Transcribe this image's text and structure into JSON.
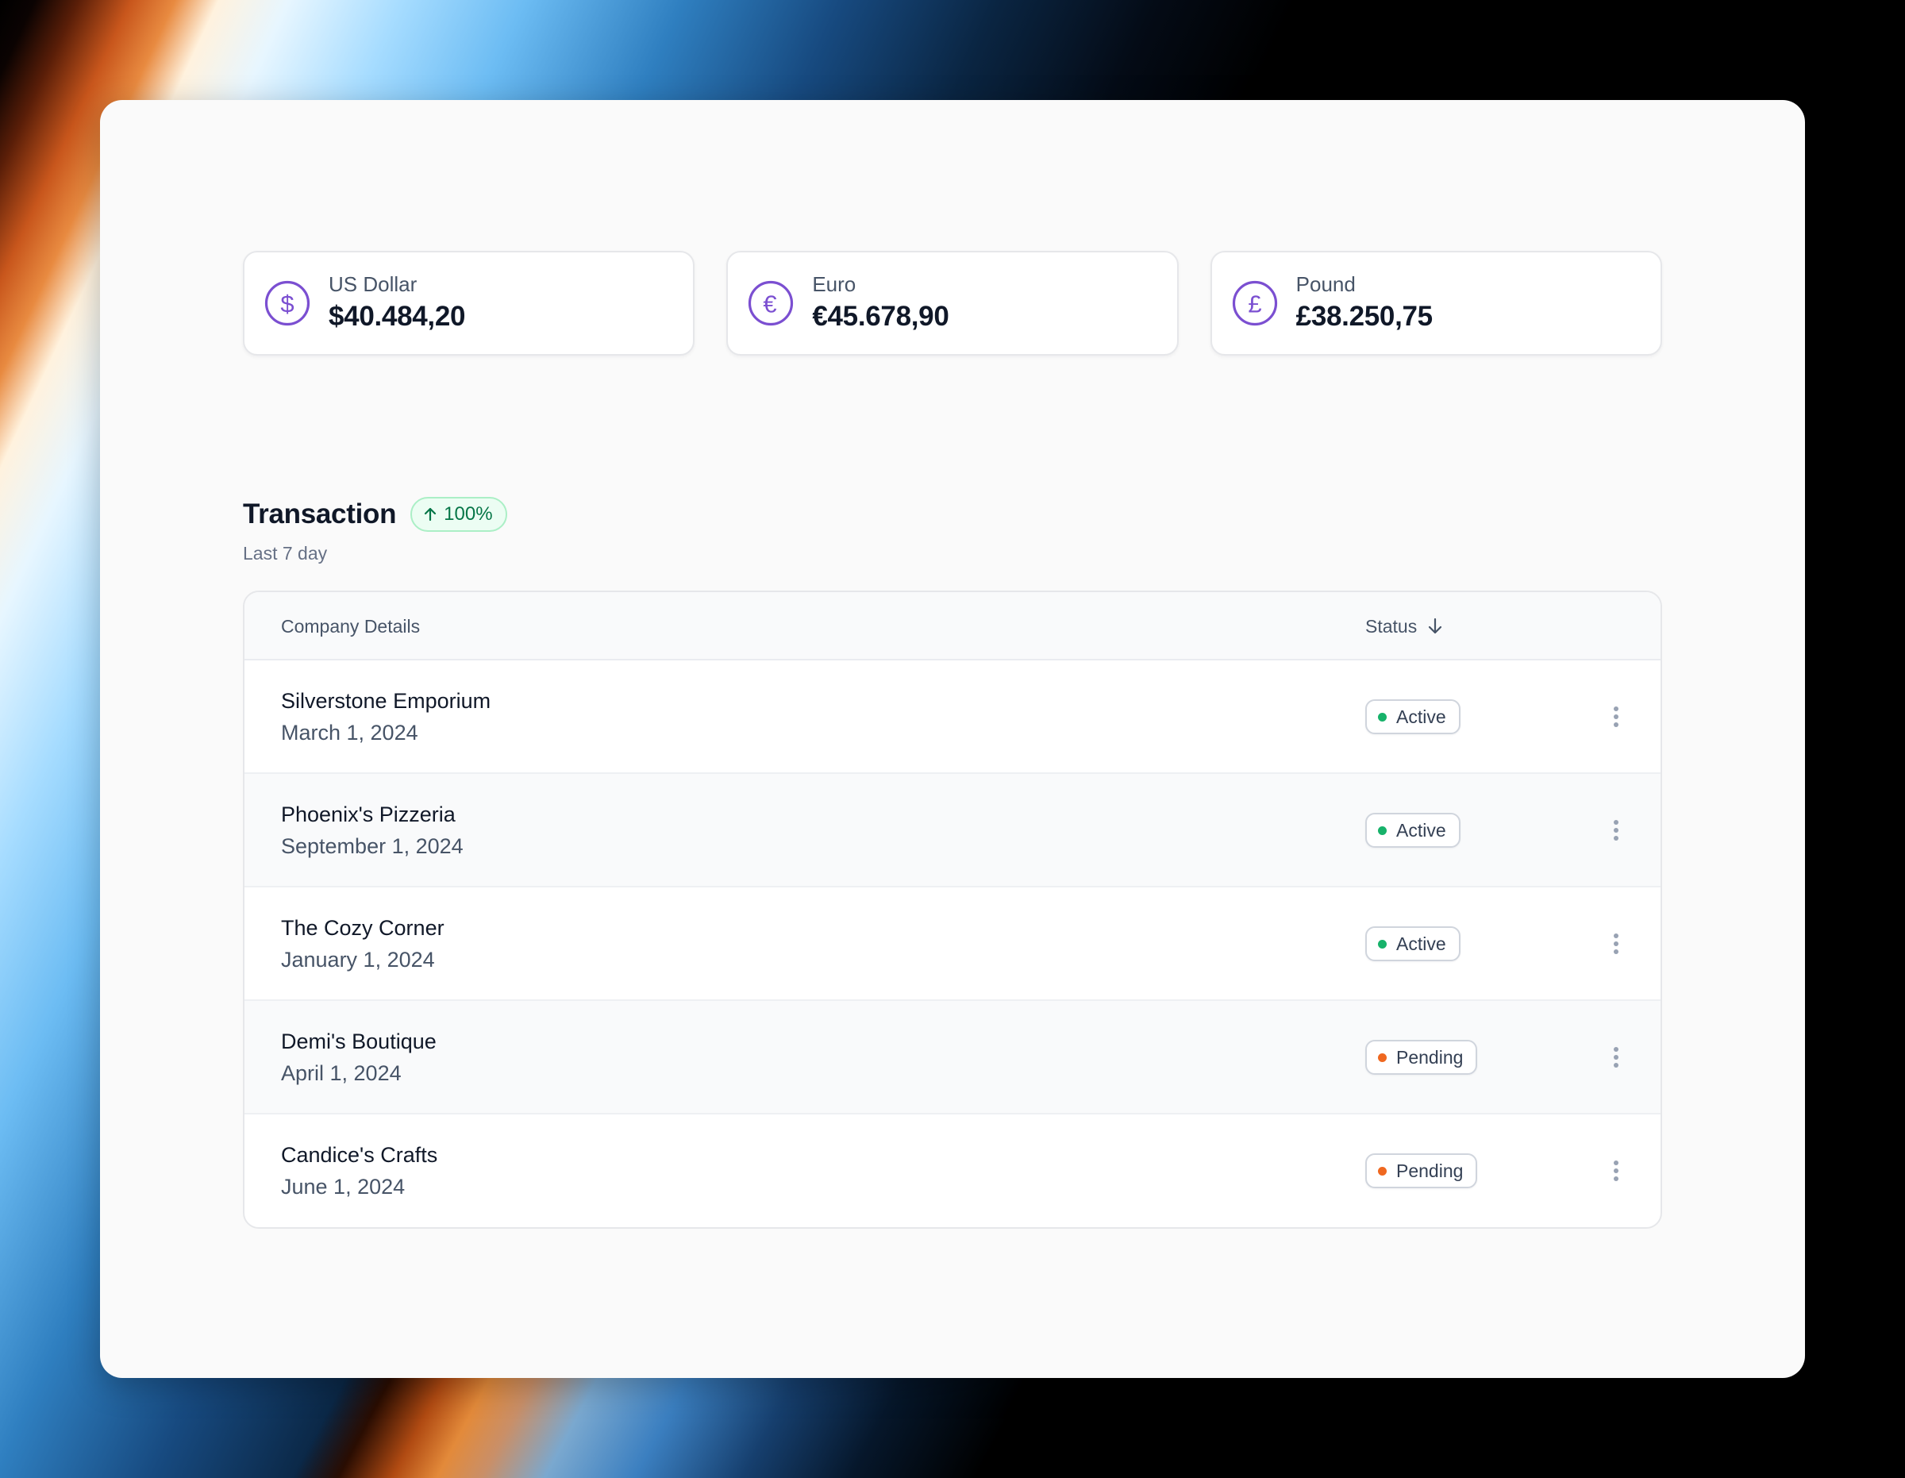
{
  "colors": {
    "accent_purple": "#7b4fd1",
    "status_active": "#17b26a",
    "status_pending": "#ef6820",
    "trend_green": "#067647"
  },
  "currencies": [
    {
      "icon": "dollar-circle-icon",
      "label": "US Dollar",
      "value": "$40.484,20"
    },
    {
      "icon": "euro-circle-icon",
      "label": "Euro",
      "value": "€45.678,90"
    },
    {
      "icon": "pound-circle-icon",
      "label": "Pound",
      "value": "£38.250,75"
    }
  ],
  "transactions": {
    "title": "Transaction",
    "trend": {
      "icon": "arrow-up-icon",
      "value": "100%"
    },
    "subtitle": "Last 7 day",
    "columns": {
      "company": "Company Details",
      "status": "Status",
      "status_sort_icon": "arrow-down-icon"
    },
    "rows": [
      {
        "name": "Silverstone Emporium",
        "date": "March 1, 2024",
        "status": "Active"
      },
      {
        "name": "Phoenix's Pizzeria",
        "date": "September 1, 2024",
        "status": "Active"
      },
      {
        "name": "The Cozy Corner",
        "date": "January 1, 2024",
        "status": "Active"
      },
      {
        "name": "Demi's Boutique",
        "date": "April 1, 2024",
        "status": "Pending"
      },
      {
        "name": "Candice's Crafts",
        "date": "June 1, 2024",
        "status": "Pending"
      }
    ],
    "row_menu_icon": "more-vertical-icon"
  }
}
